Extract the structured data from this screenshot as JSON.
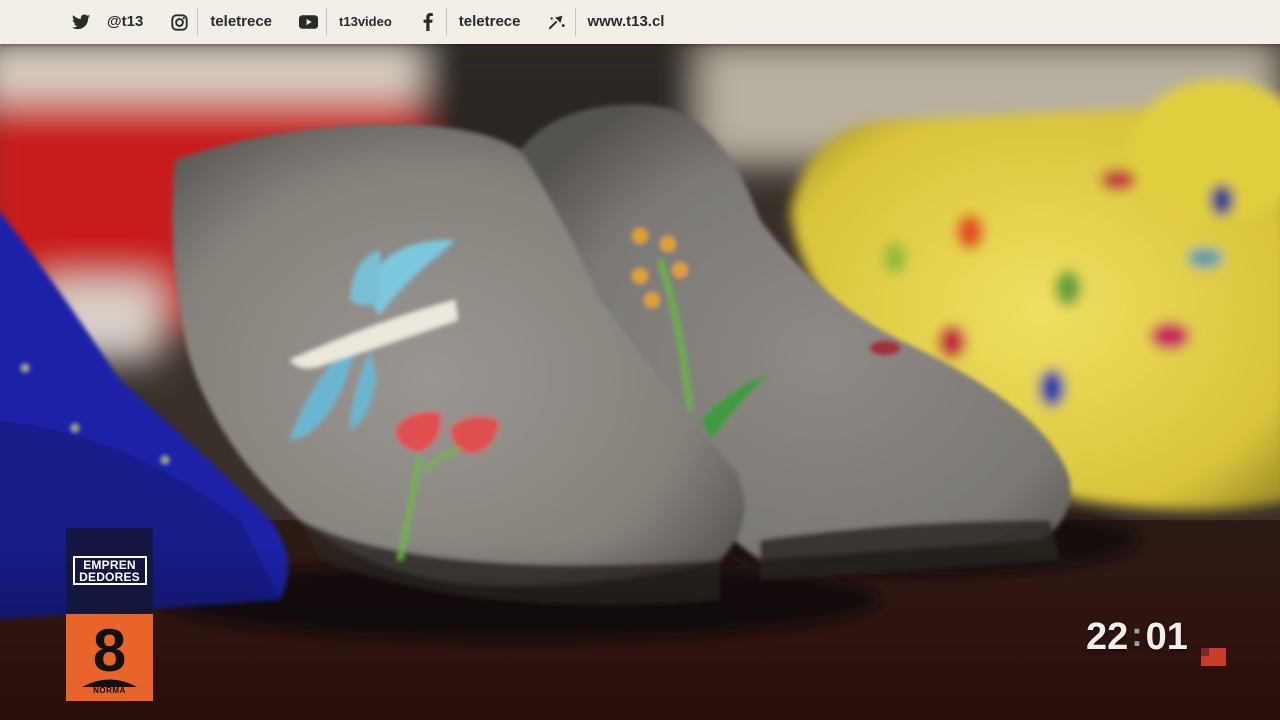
{
  "social_bar": {
    "items": [
      {
        "icon": "twitter-icon",
        "label": "@t13"
      },
      {
        "icon": "instagram-icon",
        "label": "teletrece"
      },
      {
        "icon": "youtube-icon",
        "label": "t13video"
      },
      {
        "icon": "facebook-icon",
        "label": "teletrece"
      },
      {
        "icon": "t13-app-icon",
        "label": "www.t13.cl"
      }
    ]
  },
  "program_badge": {
    "line1": "EMPREN",
    "line2": "DEDORES",
    "icon": "lightbulb-icon"
  },
  "rating_badge": {
    "rating": "8",
    "caption": "NORMA",
    "color": "#e8642a"
  },
  "clock": {
    "hours": "22",
    "separator": ":",
    "minutes": "01",
    "marker_color": "#c93b2a"
  },
  "colors": {
    "bar_background": "#f2efe6",
    "felt_grey": "#8f8c86",
    "felt_yellow": "#e3d24a",
    "felt_blue": "#1a1fa3",
    "felt_red": "#c41e1e"
  }
}
